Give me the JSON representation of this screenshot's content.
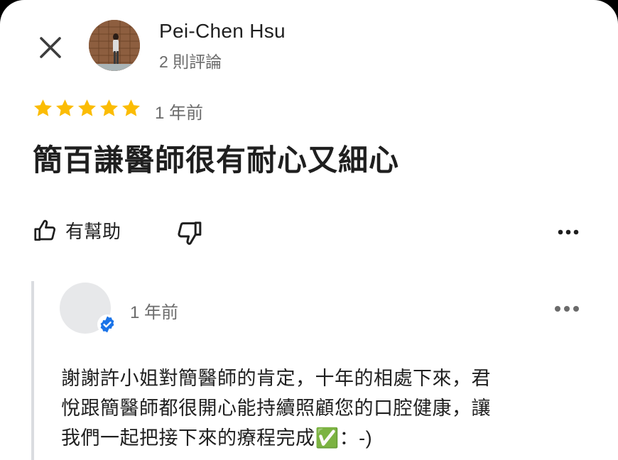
{
  "reviewer": {
    "name": "Pei-Chen Hsu",
    "review_count": "2 則評論"
  },
  "review": {
    "rating": 5,
    "time": "1 年前",
    "text": "簡百謙醫師很有耐心又細心"
  },
  "actions": {
    "helpful_label": "有幫助"
  },
  "owner_reply": {
    "time": "1 年前",
    "lines": [
      "謝謝許小姐對簡醫師的肯定，十年的相處下來，君",
      "悅跟簡醫師都很開心能持續照顧您的口腔健康，讓",
      "我們一起把接下來的療程完成✅：-)"
    ]
  },
  "colors": {
    "star": "#fbbc04",
    "verified": "#1a73e8",
    "text": "#1f1f1f",
    "secondary_text": "#6b6b6b"
  },
  "icons": [
    "close-icon",
    "thumbs-up-icon",
    "thumbs-down-icon",
    "more-icon",
    "verified-badge-icon",
    "star-icon"
  ]
}
